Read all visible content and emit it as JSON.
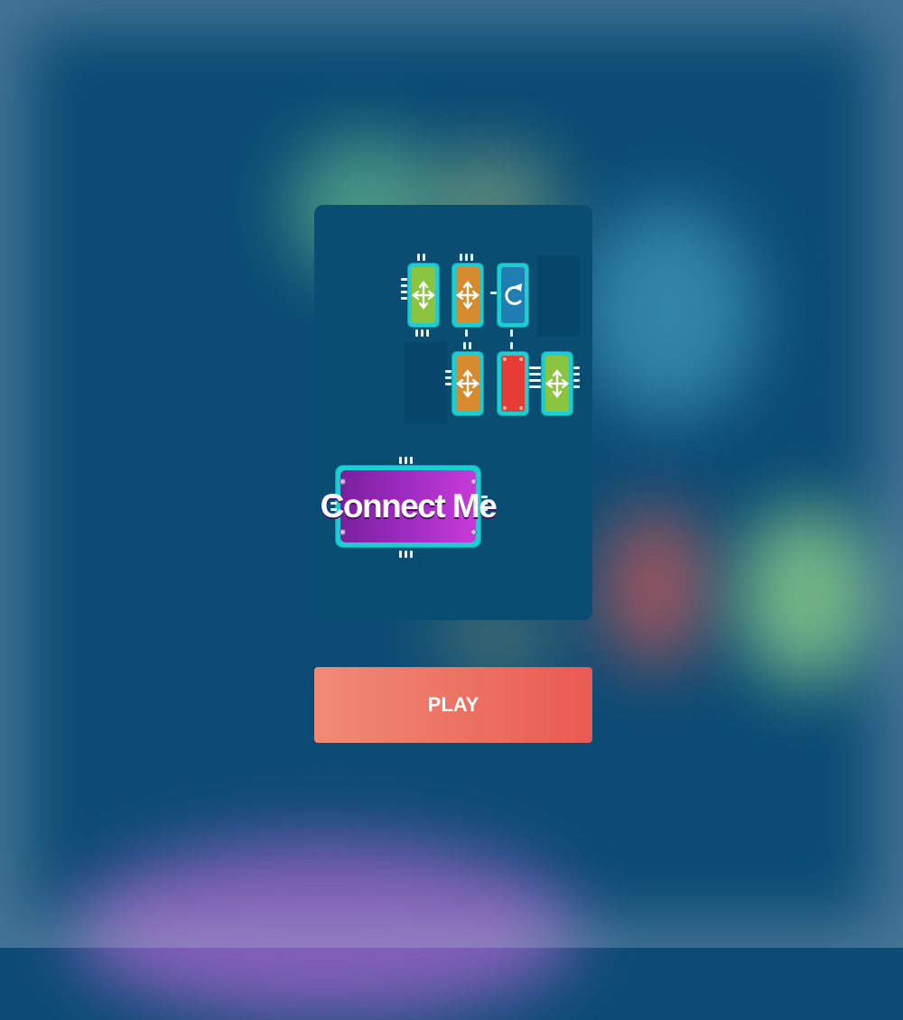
{
  "game": {
    "title": "Connect Me",
    "play_label": "PLAY"
  },
  "preview": {
    "tiles": [
      {
        "row": 0,
        "col": 0,
        "type": "free-move",
        "color": "#8bc53f",
        "icon": "four-way-arrows-icon"
      },
      {
        "row": 0,
        "col": 1,
        "type": "free-move",
        "color": "#d78a2e",
        "icon": "four-way-arrows-icon"
      },
      {
        "row": 0,
        "col": 2,
        "type": "rotate",
        "color": "#1f7fb3",
        "icon": "rotate-icon"
      },
      {
        "row": 1,
        "col": 1,
        "type": "free-move",
        "color": "#d78a2e",
        "icon": "four-way-arrows-icon"
      },
      {
        "row": 1,
        "col": 2,
        "type": "fixed",
        "color": "#e63c35",
        "icon": "rivets-icon"
      },
      {
        "row": 1,
        "col": 3,
        "type": "free-move",
        "color": "#8bc53f",
        "icon": "four-way-arrows-icon"
      }
    ]
  },
  "colors": {
    "background": "#0b4b74",
    "panel": "#0a4d73",
    "play_button": "#ec6f60",
    "logo": "#a32dc6"
  }
}
